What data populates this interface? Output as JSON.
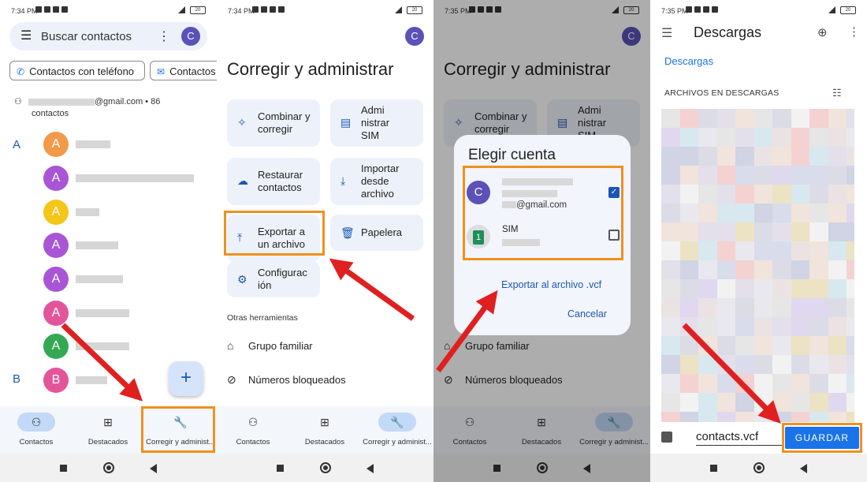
{
  "status": {
    "s1_time": "7:34 PM",
    "s2_time": "7:34 PM",
    "s3_time": "7:35 PM",
    "s4_time": "7:35 PM",
    "battery": "20"
  },
  "screen1": {
    "search_placeholder": "Buscar contactos",
    "avatar_letter": "C",
    "chip_phone": "Contactos con teléfono",
    "chip_other": "Contactos",
    "account_suffix": "@gmail.com • 86",
    "account_count_label": "contactos",
    "section_a": "A",
    "section_b": "B",
    "contact_initials": [
      "A",
      "A",
      "A",
      "A",
      "A",
      "A",
      "A",
      "B"
    ],
    "contact_colors": [
      "#f2994a",
      "#a855d6",
      "#f5c518",
      "#a855d6",
      "#a855d6",
      "#e2559b",
      "#34a853",
      "#e2559b"
    ],
    "fab_icon": "+"
  },
  "bottom_nav": {
    "contacts": "Contactos",
    "featured": "Destacados",
    "fix_manage": "Corregir y administ..."
  },
  "fix_manage": {
    "avatar_letter": "C",
    "title": "Corregir y administrar",
    "cards": {
      "merge": "Combinar y corregir",
      "manage_sim": "Admi nistrar SIM",
      "restore": "Restaurar contactos",
      "import": "Importar desde archivo",
      "export": "Exportar a un archivo",
      "trash": "Papelera",
      "settings": "Configurac ión"
    },
    "other_tools": "Otras herramientas",
    "family_group": "Grupo familiar",
    "blocked_numbers": "Números bloqueados"
  },
  "choose_account_dialog": {
    "title": "Elegir cuenta",
    "google_avatar": "C",
    "google_email_suffix": "@gmail.com",
    "sim_label": "SIM",
    "sim_badge": "1",
    "export_vcf": "Exportar al archivo .vcf",
    "cancel": "Cancelar"
  },
  "downloads": {
    "title": "Descargas",
    "breadcrumb": "Descargas",
    "section": "ARCHIVOS EN DESCARGAS",
    "filename": "contacts.vcf",
    "save_button": "GUARDAR"
  },
  "colors": {
    "accent_blue": "#1a73e8",
    "highlight_orange": "#f0901e",
    "arrow_red": "#e02020"
  }
}
